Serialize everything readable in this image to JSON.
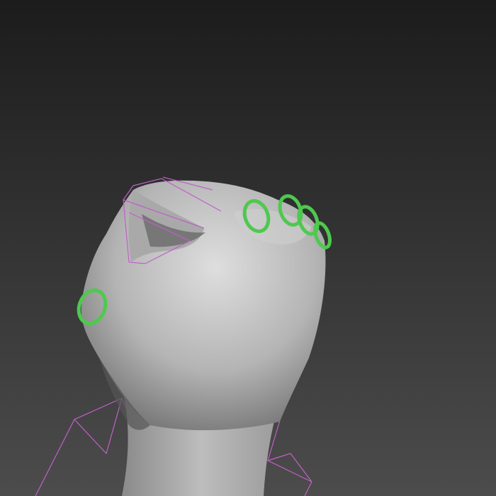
{
  "viewport": {
    "background_top": "#1c1c1c",
    "background_bottom": "#4c4c4c"
  },
  "model": {
    "subject": "hand",
    "pose": "closed-fist",
    "skin_color": "#b4b4b4",
    "skin_highlight": "#dedede",
    "skin_shadow": "#6a6a6a"
  },
  "rig": {
    "bone_color": "#c060c8",
    "joint_control_color": "#4ec94e",
    "joint_controls": [
      "thumb-joint",
      "index-knuckle",
      "middle-knuckle",
      "ring-knuckle",
      "pinky-knuckle"
    ]
  }
}
